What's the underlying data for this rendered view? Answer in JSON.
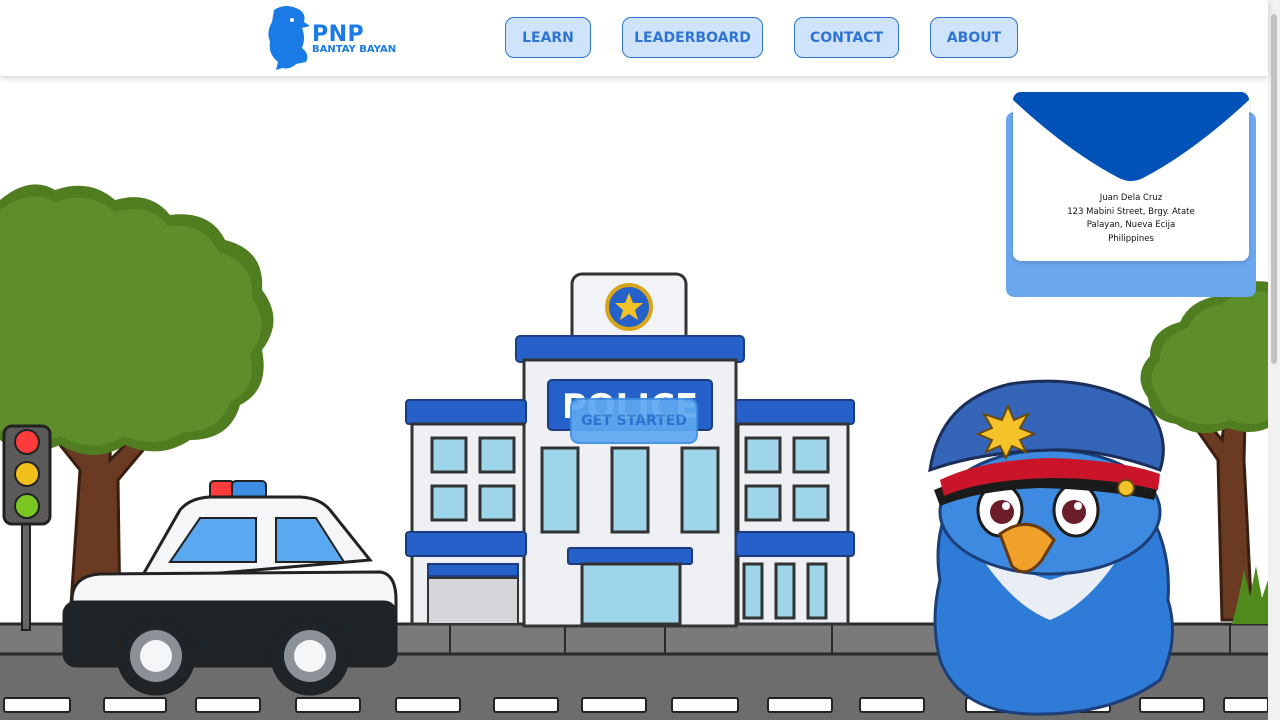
{
  "header": {
    "logo": {
      "title": "PNP",
      "subtitle": "BANTAY BAYAN"
    },
    "nav": [
      {
        "label": "LEARN"
      },
      {
        "label": "LEADERBOARD"
      },
      {
        "label": "CONTACT"
      },
      {
        "label": "ABOUT"
      }
    ]
  },
  "hero": {
    "cta_label": "GET STARTED",
    "building_sign": "POLICE"
  },
  "envelope": {
    "address_lines": [
      "Juan Dela Cruz",
      "123 Mabini Street, Brgy. Atate",
      "Palayan, Nueva Ecija",
      "Philippines"
    ]
  },
  "colors": {
    "brand_blue": "#1a7be6",
    "nav_bg": "#cfe3fb",
    "nav_border": "#2f74d0",
    "envelope_flap": "#0052b8",
    "envelope_back": "#6aa7ec"
  }
}
